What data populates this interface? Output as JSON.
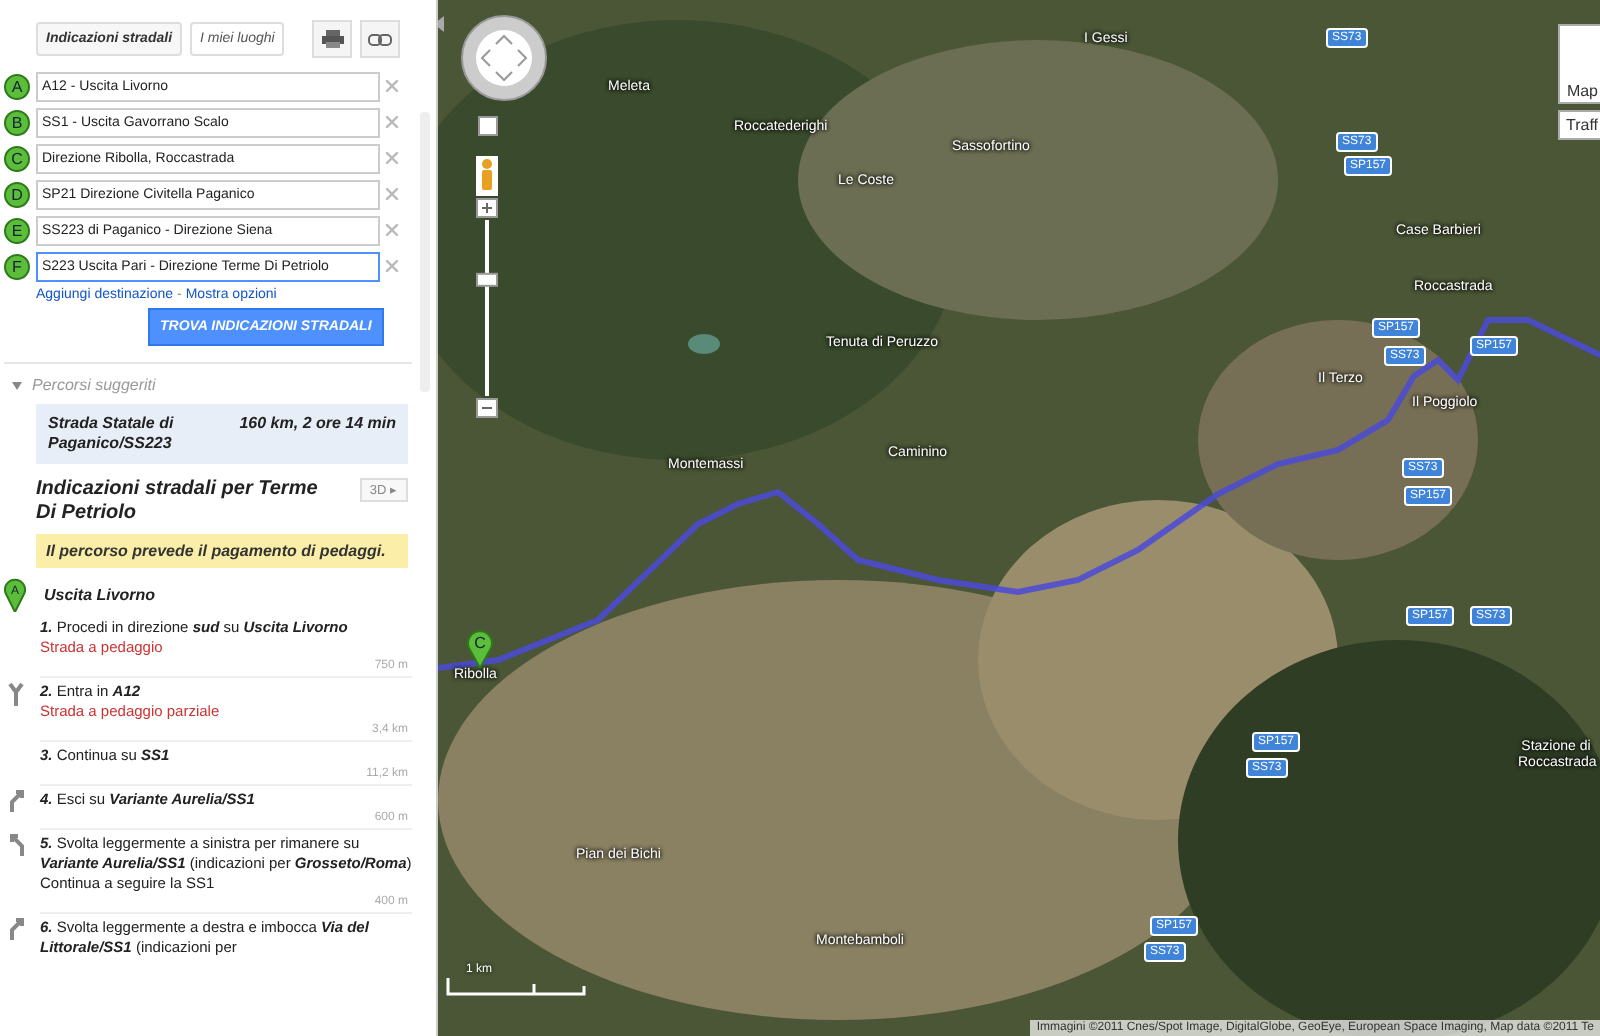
{
  "panel": {
    "tabs": [
      {
        "label": "Indicazioni stradali",
        "selected": true
      },
      {
        "label": "I miei luoghi",
        "selected": false
      }
    ],
    "waypoints": [
      {
        "letter": "A",
        "value": "A12 - Uscita Livorno",
        "focused": false
      },
      {
        "letter": "B",
        "value": "SS1 - Uscita Gavorrano Scalo",
        "focused": false
      },
      {
        "letter": "C",
        "value": "Direzione Ribolla, Roccastrada",
        "focused": false
      },
      {
        "letter": "D",
        "value": "SP21 Direzione Civitella Paganico",
        "focused": false
      },
      {
        "letter": "E",
        "value": "SS223 di Paganico - Direzione Siena",
        "focused": false
      },
      {
        "letter": "F",
        "value": "S223 Uscita Pari - Direzione Terme Di Petriolo",
        "focused": true
      }
    ],
    "links": [
      "Aggiungi destinazione",
      "-",
      "Mostra opzioni"
    ],
    "submit": "TROVA INDICAZIONI STRADALI",
    "suggested": {
      "heading": "Percorsi suggeriti",
      "expanded": true,
      "route": {
        "name": "Strada Statale di Paganico/SS223",
        "summary": "160 km, 2 ore 14 min"
      }
    },
    "directions": {
      "title": "Indicazioni stradali per Terme Di Petriolo",
      "view_button": "3D ▸",
      "notice": "Il percorso prevede il pagamento di pedaggi.",
      "start": {
        "letter": "A",
        "label": "Uscita Livorno"
      },
      "steps": [
        {
          "kind": "none",
          "text": "**1.** Procedi in direzione **sud** su **Uscita Livorno**",
          "note": "Strada a pedaggio",
          "distance": "750 m"
        },
        {
          "kind": "merge",
          "text": "**2.** Entra in **A12**",
          "note": "Strada a pedaggio parziale",
          "distance": "3,4 km"
        },
        {
          "kind": "none",
          "text": "**3.** Continua su **SS1**",
          "distance": "11,2 km"
        },
        {
          "kind": "right",
          "text": "**4.** Esci su **Variante Aurelia/SS1**",
          "distance": "600 m"
        },
        {
          "kind": "left",
          "text": "**5.** Svolta leggermente a sinistra per rimanere su **Variante Aurelia/SS1** (indicazioni per **Grosseto/Roma**)",
          "extra": "Continua a seguire la SS1",
          "distance": "400 m"
        },
        {
          "kind": "right",
          "text": "**6.** Svolta leggermente a destra e imbocca **Via del Littorale/SS1** (indicazioni per"
        }
      ]
    }
  },
  "map": {
    "places": [
      "Meleta",
      "Roccatederighi",
      "Sassofortino",
      "Le Coste",
      "Tenuta di Peruzzo",
      "Caminino",
      "Montemassi",
      "I Gessi",
      "Case Barbieri",
      "Roccastrada",
      "Il Terzo",
      "Il Poggiolo",
      "Ribolla",
      "Pian dei Bichi",
      "Montebamboli",
      "Stazione di Roccastrada"
    ],
    "shields": [
      "SS73",
      "SS73",
      "SP157",
      "SP157",
      "SS73",
      "SP157",
      "SS73",
      "SP157",
      "SP157",
      "SS73",
      "SP157",
      "SS73",
      "SP157",
      "SS73"
    ],
    "marker": {
      "letter": "C"
    },
    "zoom": {
      "level": 0.67
    },
    "map_types": [
      "Map",
      "Traff"
    ],
    "scale": "1 km",
    "attribution": "Immagini ©2011 Cnes/Spot Image, DigitalGlobe, GeoEye, European Space Imaging, Map data ©2011 Te"
  }
}
